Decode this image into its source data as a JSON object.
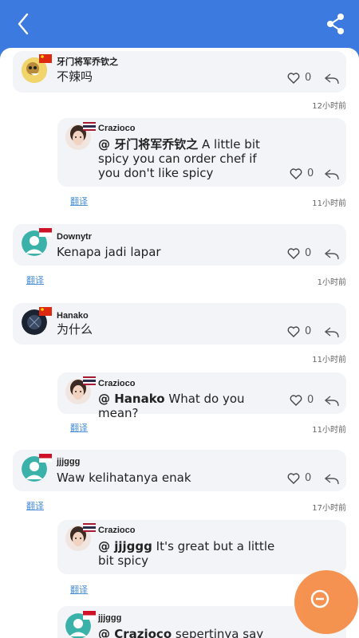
{
  "comments": [
    {
      "user": "牙门将军乔钦之",
      "text": "不辣吗",
      "likes": "0",
      "time": "12小时前"
    },
    {
      "user": "Crazioco",
      "mention": "@ 牙门将军乔钦之",
      "text": "A little bit spicy you can order chef if you don't like spicy",
      "likes": "0",
      "time": "11小时前",
      "translate": "翻译"
    },
    {
      "user": "Downytr",
      "text": "Kenapa jadi lapar",
      "likes": "0",
      "time": "1小时前",
      "translate": "翻译"
    },
    {
      "user": "Hanako",
      "text": "为什么",
      "likes": "0",
      "time": "11小时前"
    },
    {
      "user": "Crazioco",
      "mention": "@ Hanako",
      "text": "What do you mean?",
      "likes": "0",
      "time": "11小时前",
      "translate": "翻译"
    },
    {
      "user": "jjjggg",
      "text": "Waw kelihatanya enak",
      "likes": "0",
      "time": "17小时前",
      "translate": "翻译"
    },
    {
      "user": "Crazioco",
      "mention": "@ jjjggg",
      "text": "It's great but a little bit spicy",
      "translate": "翻译"
    },
    {
      "user": "jjjggg",
      "mention": "@ Crazioco",
      "text": "sepertinya say"
    }
  ],
  "colors": {
    "header": "#3d7ae0",
    "bubble": "#f2f4f8",
    "fab": "#f58d48",
    "link": "#4a8fd6"
  }
}
